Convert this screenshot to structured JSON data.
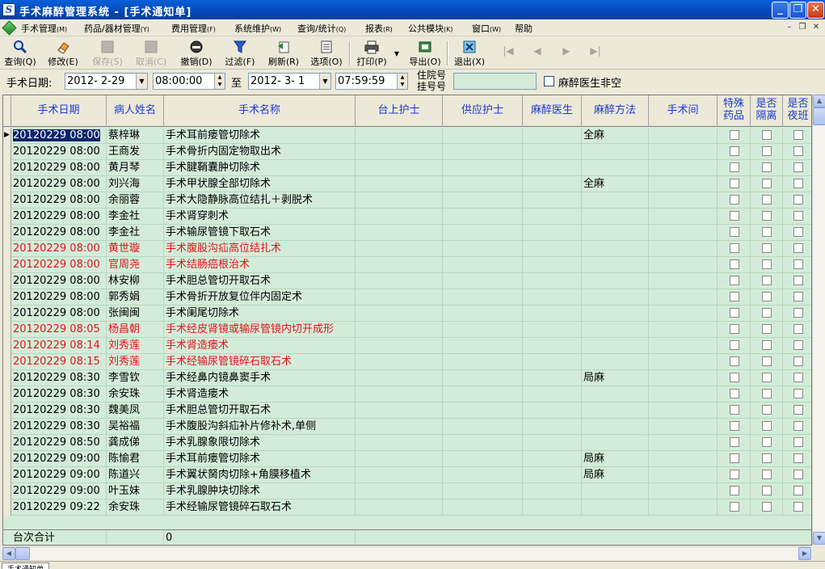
{
  "window": {
    "title": "手术麻醉管理系统 - [手术通知单]",
    "icon": "app-icon-s"
  },
  "menu": [
    {
      "label": "手术管理",
      "hotkey": "(M)"
    },
    {
      "label": "药品/器材管理",
      "hotkey": "(Y)"
    },
    {
      "label": "费用管理",
      "hotkey": "(F)"
    },
    {
      "label": "系统维护",
      "hotkey": "(W)"
    },
    {
      "label": "查询/统计",
      "hotkey": "(Q)"
    },
    {
      "label": "报表",
      "hotkey": "(R)"
    },
    {
      "label": "公共模块",
      "hotkey": "(K)"
    },
    {
      "label": "窗口",
      "hotkey": "(W)"
    },
    {
      "label": "帮助",
      "hotkey": ""
    }
  ],
  "toolbar": [
    {
      "label": "查询",
      "hotkey": "(Q)",
      "icon": "magnifier-icon",
      "enabled": true
    },
    {
      "label": "修改",
      "hotkey": "(E)",
      "icon": "eraser-icon",
      "enabled": true
    },
    {
      "label": "保存",
      "hotkey": "(S)",
      "icon": "save-icon",
      "enabled": false
    },
    {
      "label": "取消",
      "hotkey": "(C)",
      "icon": "cancel-icon",
      "enabled": false
    },
    {
      "label": "撤销",
      "hotkey": "(D)",
      "icon": "undo-icon",
      "enabled": true
    },
    {
      "label": "过滤",
      "hotkey": "(F)",
      "icon": "funnel-icon",
      "enabled": true
    },
    {
      "label": "刷新",
      "hotkey": "(R)",
      "icon": "refresh-icon",
      "enabled": true
    },
    {
      "label": "选项",
      "hotkey": "(O)",
      "icon": "options-icon",
      "enabled": true
    },
    {
      "label": "打印",
      "hotkey": "(P)",
      "icon": "printer-icon",
      "enabled": true
    },
    {
      "label": "导出",
      "hotkey": "(O)",
      "icon": "export-icon",
      "enabled": true
    },
    {
      "label": "退出",
      "hotkey": "(X)",
      "icon": "exit-icon",
      "enabled": true
    }
  ],
  "nav": {
    "first": "|◀",
    "prev": "◀",
    "next": "▶",
    "last": "▶|"
  },
  "filter": {
    "date_label": "手术日期:",
    "start_date": "2012- 2-29",
    "start_time": "08:00:00",
    "to_label": "至",
    "end_date": "2012- 3- 1",
    "end_time": "07:59:59",
    "inpatient_label": "住院号",
    "register_label": "挂号号",
    "inpatient_value": "",
    "doctor_empty_label": "麻醉医生非空"
  },
  "columns": [
    {
      "label": "手术日期"
    },
    {
      "label": "病人姓名"
    },
    {
      "label": "手术名称"
    },
    {
      "label": "台上护士"
    },
    {
      "label": "供应护士"
    },
    {
      "label": "麻醉医生"
    },
    {
      "label": "麻醉方法"
    },
    {
      "label": "手术间"
    },
    {
      "label": "特殊药品"
    },
    {
      "label": "是否隔离"
    },
    {
      "label": "是否夜班"
    }
  ],
  "rows": [
    {
      "date": "20120229 08:00",
      "name": "蔡梓琳",
      "surgery": "手术耳前瘘管切除术",
      "method": "全麻",
      "highlight": false
    },
    {
      "date": "20120229 08:00",
      "name": "王商发",
      "surgery": "手术骨折内固定物取出术",
      "method": "",
      "highlight": false
    },
    {
      "date": "20120229 08:00",
      "name": "黄月琴",
      "surgery": "手术腱鞘囊肿切除术",
      "method": "",
      "highlight": false
    },
    {
      "date": "20120229 08:00",
      "name": "刘兴海",
      "surgery": "手术甲状腺全部切除术",
      "method": "全麻",
      "highlight": false
    },
    {
      "date": "20120229 08:00",
      "name": "余丽蓉",
      "surgery": "手术大隐静脉高位结扎＋剥脱术",
      "method": "",
      "highlight": false
    },
    {
      "date": "20120229 08:00",
      "name": "李金社",
      "surgery": "手术肾穿刺术",
      "method": "",
      "highlight": false
    },
    {
      "date": "20120229 08:00",
      "name": "李金社",
      "surgery": "手术输尿管镜下取石术",
      "method": "",
      "highlight": false
    },
    {
      "date": "20120229 08:00",
      "name": "黄世璇",
      "surgery": "手术腹股沟疝高位结扎术",
      "method": "",
      "highlight": true
    },
    {
      "date": "20120229 08:00",
      "name": "官周尧",
      "surgery": "手术结肠癌根治术",
      "method": "",
      "highlight": true
    },
    {
      "date": "20120229 08:00",
      "name": "林安柳",
      "surgery": "手术胆总管切开取石术",
      "method": "",
      "highlight": false
    },
    {
      "date": "20120229 08:00",
      "name": "郭秀娟",
      "surgery": "手术骨折开放复位伴内固定术",
      "method": "",
      "highlight": false
    },
    {
      "date": "20120229 08:00",
      "name": "张闽闽",
      "surgery": "手术阑尾切除术",
      "method": "",
      "highlight": false
    },
    {
      "date": "20120229 08:05",
      "name": "杨昌朝",
      "surgery": "手术经皮肾镜或输尿管镜内切开成形",
      "method": "",
      "highlight": true
    },
    {
      "date": "20120229 08:14",
      "name": "刘秀莲",
      "surgery": "手术肾造瘘术",
      "method": "",
      "highlight": true
    },
    {
      "date": "20120229 08:15",
      "name": "刘秀莲",
      "surgery": "手术经输尿管镜碎石取石术",
      "method": "",
      "highlight": true
    },
    {
      "date": "20120229 08:30",
      "name": "李雪钦",
      "surgery": "手术经鼻内镜鼻窦手术",
      "method": "局麻",
      "highlight": false
    },
    {
      "date": "20120229 08:30",
      "name": "余安珠",
      "surgery": "手术肾造瘘术",
      "method": "",
      "highlight": false
    },
    {
      "date": "20120229 08:30",
      "name": "魏美凤",
      "surgery": "手术胆总管切开取石术",
      "method": "",
      "highlight": false
    },
    {
      "date": "20120229 08:30",
      "name": "吴裕福",
      "surgery": "手术腹股沟斜疝补片修补术,单侧",
      "method": "",
      "highlight": false
    },
    {
      "date": "20120229 08:50",
      "name": "龚成俤",
      "surgery": "手术乳腺象限切除术",
      "method": "",
      "highlight": false
    },
    {
      "date": "20120229 09:00",
      "name": "陈愉君",
      "surgery": "手术耳前瘘管切除术",
      "method": "局麻",
      "highlight": false
    },
    {
      "date": "20120229 09:00",
      "name": "陈道兴",
      "surgery": "手术翼状胬肉切除+角膜移植术",
      "method": "局麻",
      "highlight": false
    },
    {
      "date": "20120229 09:00",
      "name": "叶玉妹",
      "surgery": "手术乳腺肿块切除术",
      "method": "",
      "highlight": false
    },
    {
      "date": "20120229 09:22",
      "name": "余安珠",
      "surgery": "手术经输尿管镜碎石取石术",
      "method": "",
      "highlight": false
    }
  ],
  "footer": {
    "label": "台次合计",
    "count": "0"
  },
  "statusbar": {
    "tab_label": "手术通知单"
  },
  "colors": {
    "grid_bg": "#d3ecd9",
    "header_text": "#1c3ad0",
    "highlight_text": "#e0141c"
  }
}
